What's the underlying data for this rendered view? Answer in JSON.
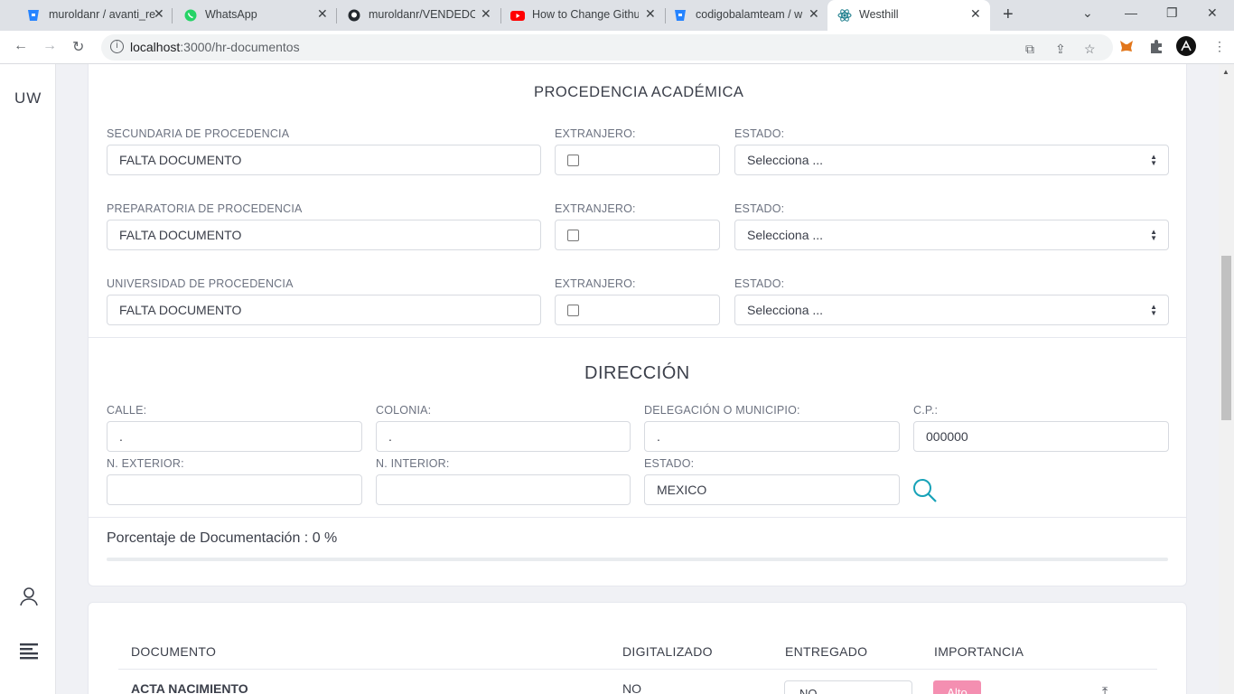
{
  "browser": {
    "tabs": [
      {
        "label": "muroldanr / avanti_re",
        "icon": "bitbucket-icon"
      },
      {
        "label": "WhatsApp",
        "icon": "whatsapp-icon"
      },
      {
        "label": "muroldanr/VENDEDO",
        "icon": "github-icon"
      },
      {
        "label": "How to Change Githu",
        "icon": "youtube-icon"
      },
      {
        "label": "codigobalamteam / w",
        "icon": "bitbucket-icon"
      },
      {
        "label": "Westhill",
        "icon": "react-icon"
      }
    ],
    "active_tab": 5,
    "url_host": "localhost",
    "url_path": ":3000/hr-documentos"
  },
  "sidebar": {
    "brand": "UW"
  },
  "procedencia": {
    "title": "PROCEDENCIA ACADÉMICA",
    "rows": [
      {
        "school_label": "SECUNDARIA DE PROCEDENCIA",
        "school_value": "FALTA DOCUMENTO",
        "foreign_label": "EXTRANJERO:",
        "foreign_checked": false,
        "state_label": "ESTADO:",
        "state_value": "Selecciona ..."
      },
      {
        "school_label": "PREPARATORIA DE PROCEDENCIA",
        "school_value": "FALTA DOCUMENTO",
        "foreign_label": "EXTRANJERO:",
        "foreign_checked": false,
        "state_label": "ESTADO:",
        "state_value": "Selecciona ..."
      },
      {
        "school_label": "UNIVERSIDAD DE PROCEDENCIA",
        "school_value": "FALTA DOCUMENTO",
        "foreign_label": "EXTRANJERO:",
        "foreign_checked": false,
        "state_label": "ESTADO:",
        "state_value": "Selecciona ..."
      }
    ]
  },
  "direccion": {
    "title": "DIRECCIÓN",
    "calle_label": "CALLE:",
    "calle_value": ".",
    "colonia_label": "COLONIA:",
    "colonia_value": ".",
    "municipio_label": "DELEGACIÓN O MUNICIPIO:",
    "municipio_value": ".",
    "cp_label": "C.P.:",
    "cp_value": "000000",
    "exterior_label": "N. EXTERIOR:",
    "exterior_value": "",
    "interior_label": "N. INTERIOR:",
    "interior_value": "",
    "estado_label": "ESTADO:",
    "estado_value": "MEXICO"
  },
  "documentacion": {
    "text": "Porcentaje de Documentación : 0 %",
    "percent": 0
  },
  "documentos_table": {
    "headers": [
      "DOCUMENTO",
      "DIGITALIZADO",
      "ENTREGADO",
      "IMPORTANCIA"
    ],
    "rows": [
      {
        "documento": "ACTA NACIMIENTO",
        "digitalizado": "NO",
        "entregado": "NO",
        "importancia": "Alto"
      }
    ]
  },
  "colors": {
    "accent": "#17a2b8",
    "badge": "#f48fb1"
  }
}
